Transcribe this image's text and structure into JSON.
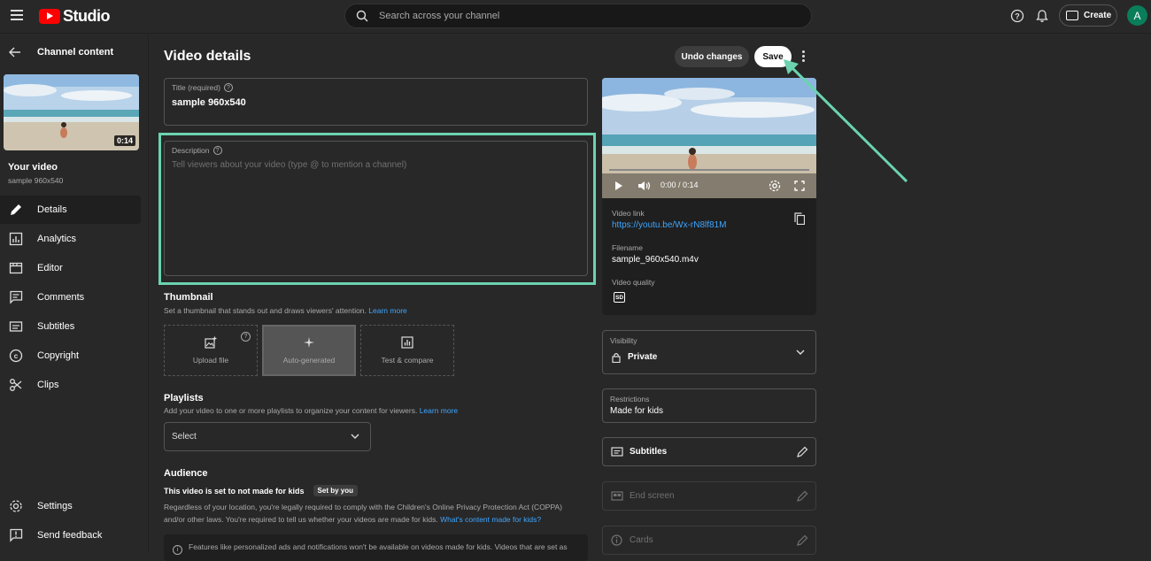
{
  "app": {
    "logo_text": "Studio",
    "avatar_letter": "A"
  },
  "search": {
    "placeholder": "Search across your channel"
  },
  "header": {
    "create_label": "Create"
  },
  "sidebar": {
    "back_label": "Channel content",
    "thumbnail_duration": "0:14",
    "your_video_label": "Your video",
    "video_name": "sample 960x540",
    "items": [
      {
        "label": "Details",
        "icon": "pencil-icon",
        "active": true
      },
      {
        "label": "Analytics",
        "icon": "analytics-icon"
      },
      {
        "label": "Editor",
        "icon": "editor-icon"
      },
      {
        "label": "Comments",
        "icon": "comments-icon"
      },
      {
        "label": "Subtitles",
        "icon": "subtitles-icon"
      },
      {
        "label": "Copyright",
        "icon": "copyright-icon"
      },
      {
        "label": "Clips",
        "icon": "scissors-icon"
      }
    ],
    "bottom_items": [
      {
        "label": "Settings",
        "icon": "gear-icon"
      },
      {
        "label": "Send feedback",
        "icon": "feedback-icon"
      }
    ]
  },
  "main": {
    "title": "Video details",
    "undo_label": "Undo changes",
    "save_label": "Save",
    "title_field": {
      "label": "Title (required)",
      "value": "sample 960x540"
    },
    "description_field": {
      "label": "Description",
      "placeholder": "Tell viewers about your video (type @ to mention a channel)"
    },
    "thumbnail": {
      "heading": "Thumbnail",
      "desc": "Set a thumbnail that stands out and draws viewers' attention.",
      "learn_more": "Learn more",
      "options": [
        "Upload file",
        "Auto-generated",
        "Test & compare"
      ]
    },
    "playlists": {
      "heading": "Playlists",
      "desc": "Add your video to one or more playlists to organize your content for viewers.",
      "learn_more": "Learn more",
      "select_value": "Select"
    },
    "audience": {
      "heading": "Audience",
      "status": "This video is set to not made for kids",
      "badge": "Set by you",
      "desc": "Regardless of your location, you're legally required to comply with the Children's Online Privacy Protection Act (COPPA) and/or other laws. You're required to tell us whether your videos are made for kids.",
      "desc_link": "What's content made for kids?",
      "info": "Features like personalized ads and notifications won't be available on videos made for kids. Videos that are set as"
    }
  },
  "preview": {
    "time": "0:00 / 0:14",
    "video_link_label": "Video link",
    "video_link": "https://youtu.be/Wx-rN8lf81M",
    "filename_label": "Filename",
    "filename": "sample_960x540.m4v",
    "quality_label": "Video quality",
    "quality_badge": "SD"
  },
  "right_panel": {
    "visibility_label": "Visibility",
    "visibility_value": "Private",
    "restrictions_label": "Restrictions",
    "restrictions_value": "Made for kids",
    "subtitles_label": "Subtitles",
    "end_screen_label": "End screen",
    "cards_label": "Cards"
  },
  "colors": {
    "accent": "#3ea6ff",
    "highlight": "#6bd3b0",
    "brand": "#ff0000"
  }
}
